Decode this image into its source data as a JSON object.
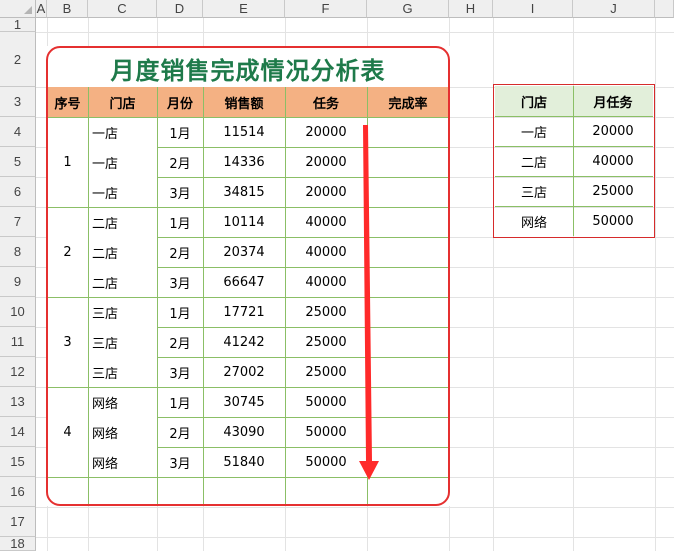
{
  "spreadsheet": {
    "columns": [
      "A",
      "B",
      "C",
      "D",
      "E",
      "F",
      "G",
      "H",
      "I",
      "J"
    ],
    "rows": [
      "1",
      "2",
      "3",
      "4",
      "5",
      "6",
      "7",
      "8",
      "9",
      "10",
      "11",
      "12",
      "13",
      "14",
      "15",
      "16",
      "17",
      "18"
    ]
  },
  "main_table": {
    "title": "月度销售完成情况分析表",
    "headers": [
      "序号",
      "门店",
      "月份",
      "销售额",
      "任务",
      "完成率"
    ],
    "groups": [
      "1",
      "2",
      "3",
      "4"
    ],
    "rows": [
      {
        "store": "一店",
        "month": "1月",
        "sales": "11514",
        "task": "20000",
        "rate": ""
      },
      {
        "store": "一店",
        "month": "2月",
        "sales": "14336",
        "task": "20000",
        "rate": ""
      },
      {
        "store": "一店",
        "month": "3月",
        "sales": "34815",
        "task": "20000",
        "rate": ""
      },
      {
        "store": "二店",
        "month": "1月",
        "sales": "10114",
        "task": "40000",
        "rate": ""
      },
      {
        "store": "二店",
        "month": "2月",
        "sales": "20374",
        "task": "40000",
        "rate": ""
      },
      {
        "store": "二店",
        "month": "3月",
        "sales": "66647",
        "task": "40000",
        "rate": ""
      },
      {
        "store": "三店",
        "month": "1月",
        "sales": "17721",
        "task": "25000",
        "rate": ""
      },
      {
        "store": "三店",
        "month": "2月",
        "sales": "41242",
        "task": "25000",
        "rate": ""
      },
      {
        "store": "三店",
        "month": "3月",
        "sales": "27002",
        "task": "25000",
        "rate": ""
      },
      {
        "store": "网络",
        "month": "1月",
        "sales": "30745",
        "task": "50000",
        "rate": ""
      },
      {
        "store": "网络",
        "month": "2月",
        "sales": "43090",
        "task": "50000",
        "rate": ""
      },
      {
        "store": "网络",
        "month": "3月",
        "sales": "51840",
        "task": "50000",
        "rate": ""
      }
    ]
  },
  "task_table": {
    "headers": [
      "门店",
      "月任务"
    ],
    "rows": [
      {
        "store": "一店",
        "task": "20000"
      },
      {
        "store": "二店",
        "task": "40000"
      },
      {
        "store": "三店",
        "task": "25000"
      },
      {
        "store": "网络",
        "task": "50000"
      }
    ]
  },
  "colors": {
    "title": "#1e7a4a",
    "header_fill": "#f4b183",
    "task_header_fill": "#e2efda",
    "frame": "#e53030",
    "grid": "#8bbf66"
  }
}
